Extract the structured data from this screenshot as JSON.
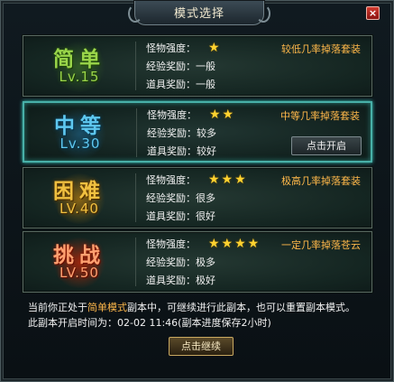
{
  "dialog": {
    "title": "模式选择",
    "close_label": "×",
    "modes": [
      {
        "name": "简单",
        "level": "Lv.15",
        "strength_label": "怪物强度：",
        "stars": "★",
        "exp_label": "经验奖励：",
        "exp": "一般",
        "item_label": "道具奖励：",
        "item": "一般",
        "drop_note": "较低几率掉落套装"
      },
      {
        "name": "中等",
        "level": "Lv.30",
        "strength_label": "怪物强度：",
        "stars": "★★",
        "exp_label": "经验奖励：",
        "exp": "较多",
        "item_label": "道具奖励：",
        "item": "较好",
        "drop_note": "中等几率掉落套装",
        "button": "点击开启"
      },
      {
        "name": "困难",
        "level": "LV.40",
        "strength_label": "怪物强度：",
        "stars": "★★★",
        "exp_label": "经验奖励：",
        "exp": "很多",
        "item_label": "道具奖励：",
        "item": "很好",
        "drop_note": "极高几率掉落套装"
      },
      {
        "name": "挑战",
        "level": "LV.50",
        "strength_label": "怪物强度：",
        "stars": "★★★★",
        "exp_label": "经验奖励：",
        "exp": "极多",
        "item_label": "道具奖励：",
        "item": "极好",
        "drop_note": "一定几率掉落苍云"
      }
    ],
    "notice": {
      "line1_prefix": "当前你正处于",
      "line1_mode": "简单模式",
      "line1_suffix": "副本中，可继续进行此副本，也可以重置副本模式。",
      "line2_prefix": "此副本开启时间为：",
      "line2_time": "02-02 11:46",
      "line2_suffix": "(副本进度保存2小时)"
    },
    "continue_label": "点击继续"
  },
  "colors": {
    "accent_gold": "#ffb84a",
    "star": "#ffd230",
    "selected_border": "#48b0a8"
  }
}
